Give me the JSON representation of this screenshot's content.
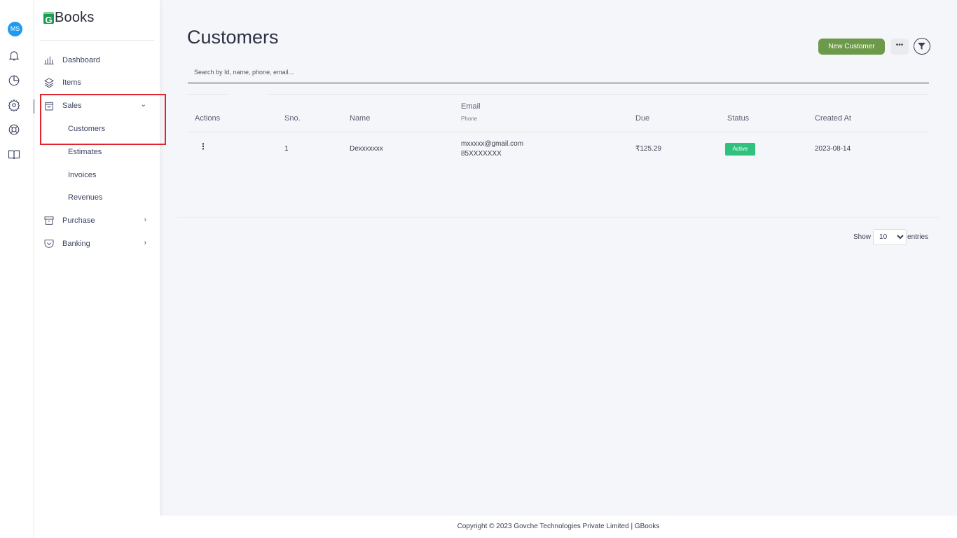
{
  "rail": {
    "avatar_initials": "MS",
    "icons": [
      "bell-icon",
      "pie-chart-icon",
      "gear-icon",
      "help-circle-icon",
      "book-icon"
    ]
  },
  "sidebar": {
    "logo_mark": "G",
    "logo_text": "Books",
    "items": [
      {
        "label": "Dashboard",
        "icon": "bar-chart-icon"
      },
      {
        "label": "Items",
        "icon": "layers-icon"
      },
      {
        "label": "Sales",
        "icon": "shopping-bag-icon",
        "expanded": true,
        "subitems": [
          {
            "label": "Customers"
          },
          {
            "label": "Estimates"
          },
          {
            "label": "Invoices"
          },
          {
            "label": "Revenues"
          }
        ]
      },
      {
        "label": "Purchase",
        "icon": "archive-icon"
      },
      {
        "label": "Banking",
        "icon": "pocket-icon"
      }
    ]
  },
  "page": {
    "title": "Customers",
    "new_button": "New Customer",
    "more_button": "•••",
    "search_placeholder": "Search by Id, name, phone, email..."
  },
  "table": {
    "headers": {
      "actions": "Actions",
      "sno": "Sno.",
      "name": "Name",
      "email": "Email",
      "phone": "Phone",
      "due": "Due",
      "status": "Status",
      "created_at": "Created At"
    },
    "rows": [
      {
        "sno": "1",
        "name": "Dexxxxxxx",
        "email": "mxxxxx@gmail.com",
        "phone": "85XXXXXXX",
        "due": "₹125.29",
        "status": "Active",
        "created_at": "2023-08-14"
      }
    ]
  },
  "pagination": {
    "show_label": "Show",
    "page_size": "10",
    "entries_label": "entries"
  },
  "footer": {
    "text": "Copyright © 2023 Govche Technologies Private Limited | GBooks"
  },
  "colors": {
    "accent_green": "#6c9a4a",
    "status_active": "#2ec27e",
    "avatar_blue": "#1e9bf0",
    "highlight_red": "#e0252e"
  }
}
